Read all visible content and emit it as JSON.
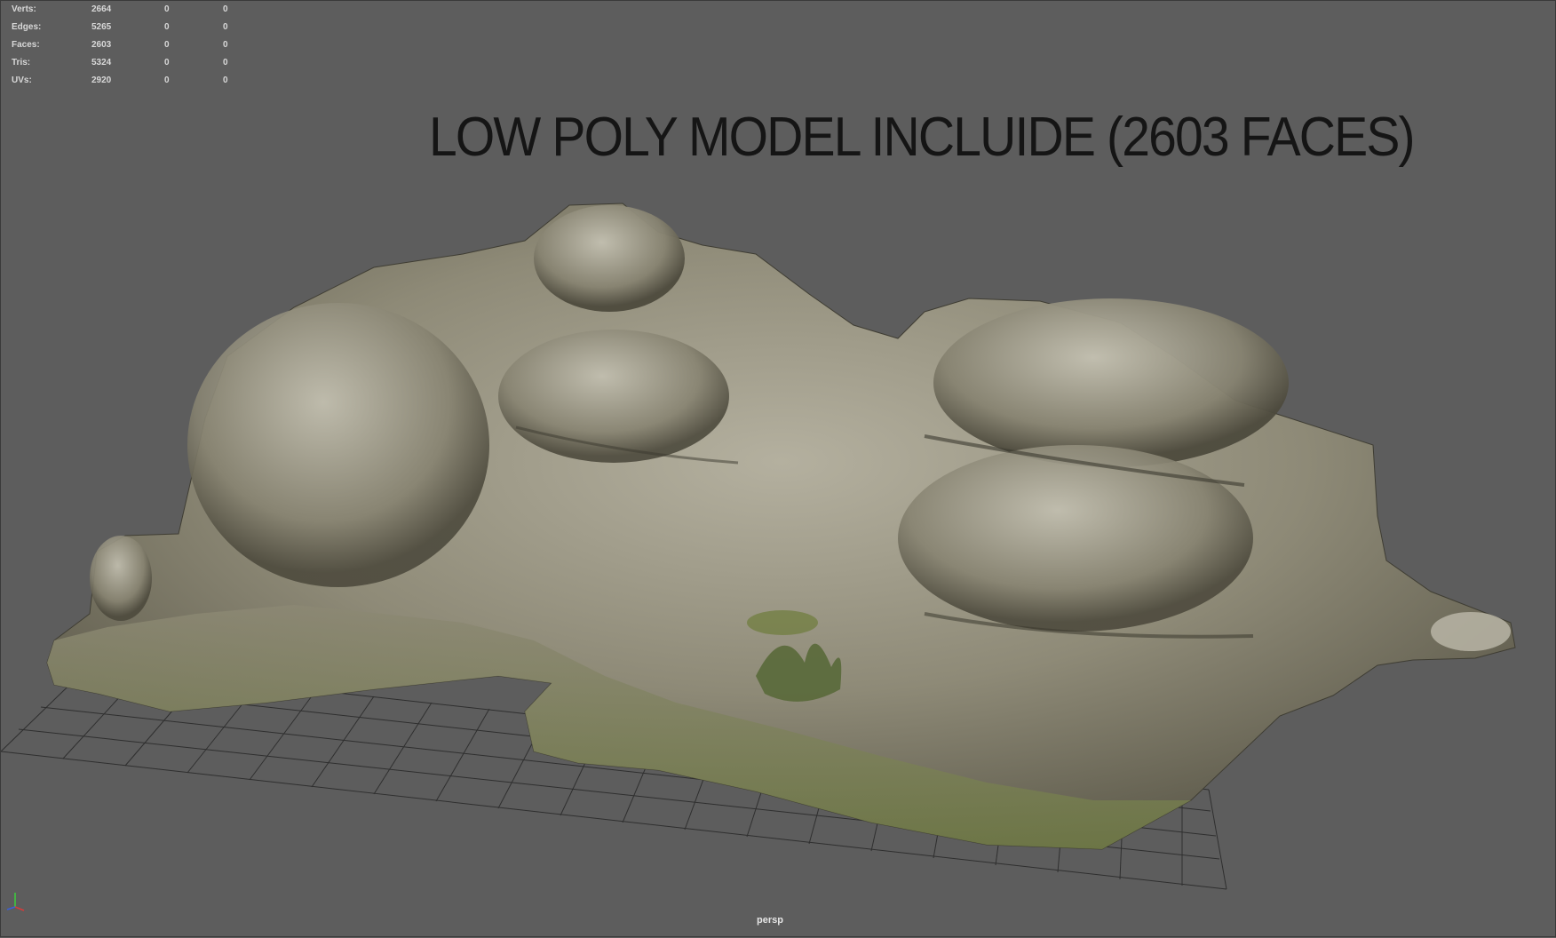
{
  "stats": {
    "rows": [
      {
        "label": "Verts:",
        "values": [
          "2664",
          "0",
          "0"
        ]
      },
      {
        "label": "Edges:",
        "values": [
          "5265",
          "0",
          "0"
        ]
      },
      {
        "label": "Faces:",
        "values": [
          "2603",
          "0",
          "0"
        ]
      },
      {
        "label": "Tris:",
        "values": [
          "5324",
          "0",
          "0"
        ]
      },
      {
        "label": "UVs:",
        "values": [
          "2920",
          "0",
          "0"
        ]
      }
    ]
  },
  "headline": "LOW POLY MODEL INCLUIDE (2603 FACES)",
  "camera": "persp",
  "colors": {
    "viewport_bg": "#5d5d5d",
    "grid_line": "#2f2f2f",
    "rock_base": "#8f8b78",
    "rock_light": "#b9b6a6",
    "rock_dark": "#4c4a3e",
    "moss": "#7b8a46"
  },
  "icons": {
    "axis": "xyz-axis-gizmo-icon"
  }
}
